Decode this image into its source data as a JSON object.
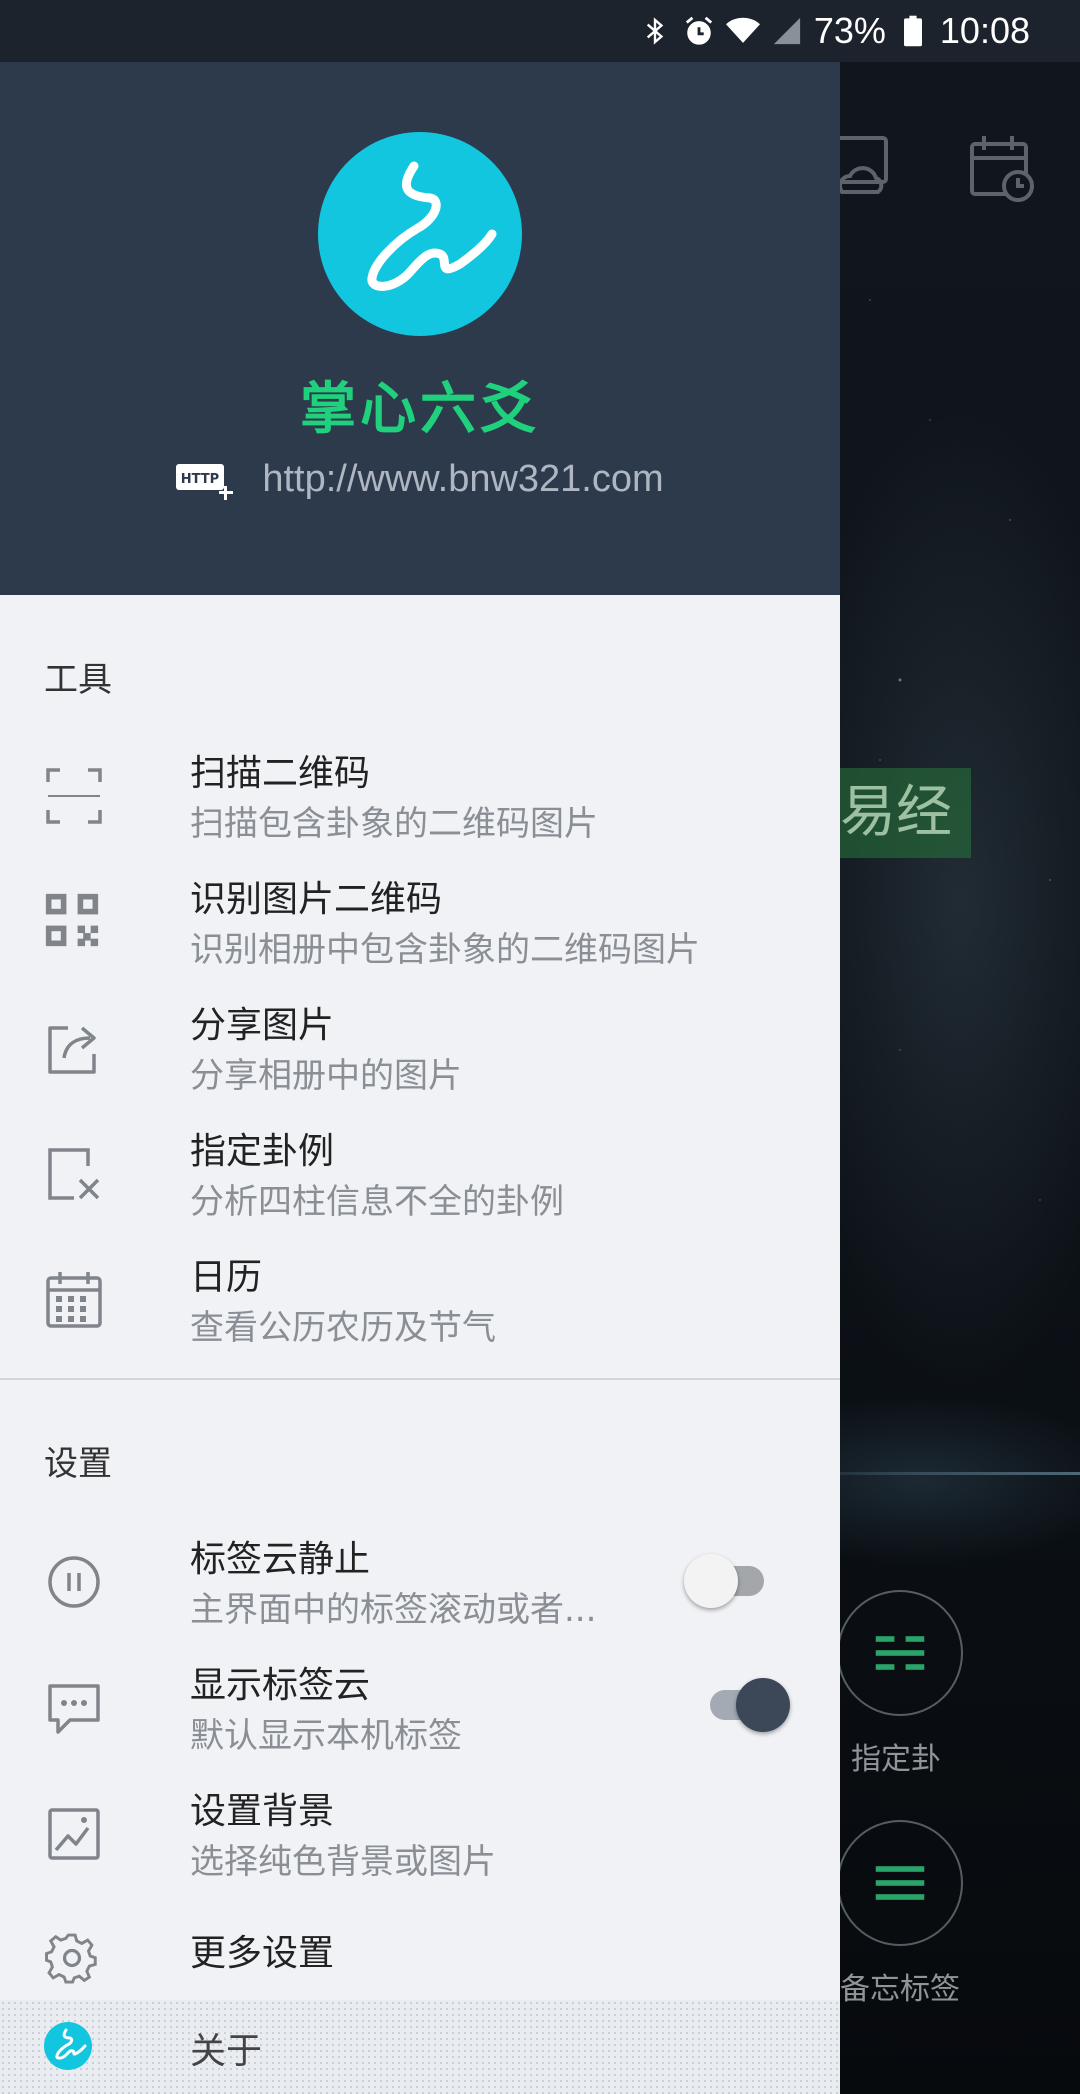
{
  "status_bar": {
    "battery": "73%",
    "time": "10:08",
    "icons": [
      "bluetooth-icon",
      "alarm-icon",
      "wifi-icon",
      "cell-signal-icon",
      "battery-icon"
    ]
  },
  "background": {
    "label_yijing": "易经",
    "circle1_label": "指定卦",
    "circle2_label": "备忘标签"
  },
  "drawer": {
    "app_name": "掌心六爻",
    "url": "http://www.bnw321.com",
    "accent_color": "#1fd17c",
    "logo_color": "#12c6df",
    "tools": {
      "title": "工具",
      "items": [
        {
          "icon": "scan-icon",
          "title": "扫描二维码",
          "subtitle": "扫描包含卦象的二维码图片"
        },
        {
          "icon": "qr-code-icon",
          "title": "识别图片二维码",
          "subtitle": "识别相册中包含卦象的二维码图片"
        },
        {
          "icon": "share-icon",
          "title": "分享图片",
          "subtitle": "分享相册中的图片"
        },
        {
          "icon": "edit-cross-icon",
          "title": "指定卦例",
          "subtitle": "分析四柱信息不全的卦例"
        },
        {
          "icon": "calendar-icon",
          "title": "日历",
          "subtitle": "查看公历农历及节气"
        }
      ]
    },
    "settings": {
      "title": "设置",
      "items": [
        {
          "icon": "pause-icon",
          "title": "标签云静止",
          "subtitle": "主界面中的标签滚动或者...",
          "toggle": false
        },
        {
          "icon": "chat-icon",
          "title": "显示标签云",
          "subtitle": "默认显示本机标签",
          "toggle": true
        },
        {
          "icon": "image-icon",
          "title": "设置背景",
          "subtitle": "选择纯色背景或图片"
        },
        {
          "icon": "gear-icon",
          "title": "更多设置"
        }
      ]
    },
    "about_label": "关于"
  }
}
